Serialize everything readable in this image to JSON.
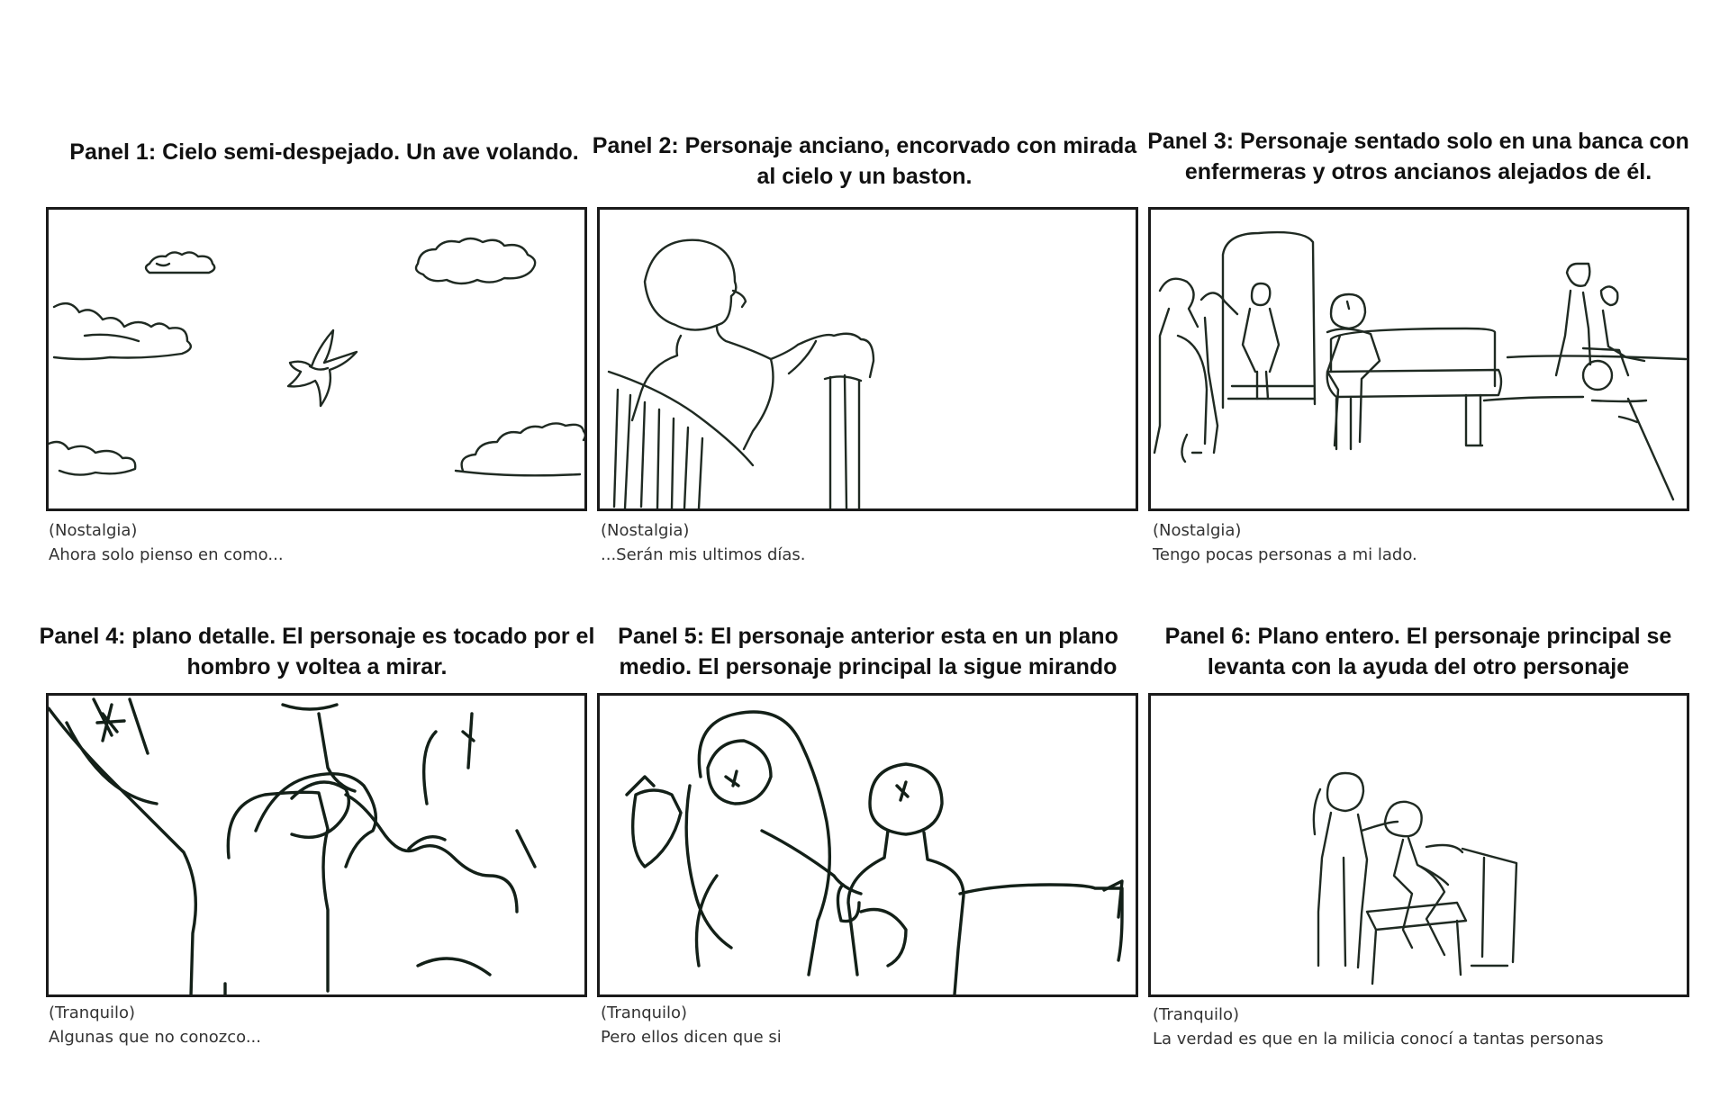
{
  "panels": [
    {
      "title_line1": "Panel 1: Cielo semi-despejado. Un ave volando.",
      "title_line2": "",
      "mood": "(Nostalgia)",
      "dialogue": "Ahora solo pienso en como...",
      "sketch_icon": "sky-clouds-bird-sketch"
    },
    {
      "title_line1": "Panel 2: Personaje anciano, encorvado con mirada",
      "title_line2": "al cielo y un baston.",
      "mood": "(Nostalgia)",
      "dialogue": "...Serán mis ultimos días.",
      "sketch_icon": "elderly-man-looking-up-sketch"
    },
    {
      "title_line1": "Panel 3: Personaje sentado solo en una banca con",
      "title_line2": "enfermeras y otros ancianos alejados de él.",
      "mood": "(Nostalgia)",
      "dialogue": "Tengo pocas personas a mi lado.",
      "sketch_icon": "bench-nurses-elders-sketch"
    },
    {
      "title_line1": "Panel 4: plano detalle. El personaje es tocado por el",
      "title_line2": "hombro y voltea a mirar.",
      "mood": "(Tranquilo)",
      "dialogue": "Algunas que no conozco...",
      "sketch_icon": "shoulder-touch-detail-sketch"
    },
    {
      "title_line1": "Panel 5: El personaje anterior esta en un plano",
      "title_line2": "medio. El personaje principal la sigue mirando",
      "mood": "(Tranquilo)",
      "dialogue": "Pero ellos dicen que si",
      "sketch_icon": "two-characters-medium-shot-sketch"
    },
    {
      "title_line1": "Panel 6: Plano entero. El personaje principal se",
      "title_line2": "levanta con la ayuda del otro personaje",
      "mood": "(Tranquilo)",
      "dialogue": "La verdad es que en la milicia conocí a tantas personas",
      "sketch_icon": "helped-to-stand-sketch"
    }
  ],
  "colors": {
    "frame_border": "#1b1b1b",
    "sketch_stroke": "#1f2a22",
    "caption_text": "#333333"
  }
}
